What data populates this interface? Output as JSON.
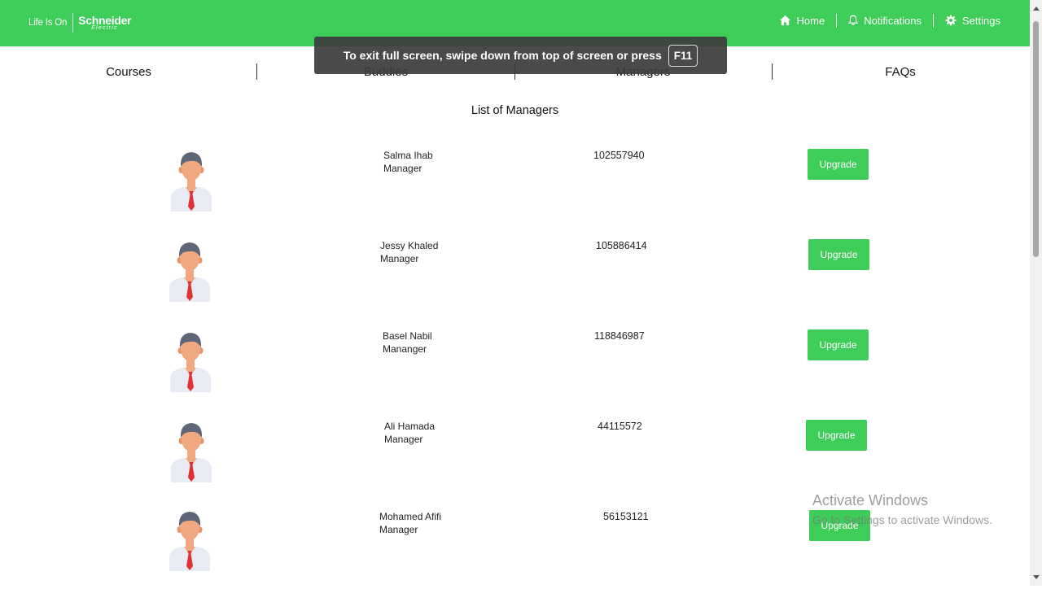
{
  "header": {
    "brand_tagline": "Life Is On",
    "brand_name": "Schneider",
    "brand_sub": "Electric",
    "nav": [
      {
        "label": "Home",
        "icon": "home-icon"
      },
      {
        "label": "Notifications",
        "icon": "bell-icon"
      },
      {
        "label": "Settings",
        "icon": "gear-icon"
      }
    ]
  },
  "tabs": [
    "Courses",
    "Buddies",
    "Managers",
    "FAQs"
  ],
  "toast": {
    "text": "To exit full screen, swipe down from top of screen or press",
    "key": "F11"
  },
  "list_title": "List of Managers",
  "managers": [
    {
      "name": "Salma Ihab",
      "role": "Manager",
      "id": "102557940",
      "action": "Upgrade"
    },
    {
      "name": "Jessy Khaled",
      "role": "Manager",
      "id": "105886414",
      "action": "Upgrade"
    },
    {
      "name": "Basel Nabil",
      "role": "Mananger",
      "id": "118846987",
      "action": "Upgrade"
    },
    {
      "name": "Ali Hamada",
      "role": "Manager",
      "id": "44115572",
      "action": "Upgrade"
    },
    {
      "name": "Mohamed Afifi",
      "role": "Manager",
      "id": "56153121",
      "action": "Upgrade"
    }
  ],
  "watermark": {
    "line1": "Activate Windows",
    "line2": "Go to Settings to activate Windows."
  },
  "colors": {
    "accent": "#3dcd58"
  }
}
